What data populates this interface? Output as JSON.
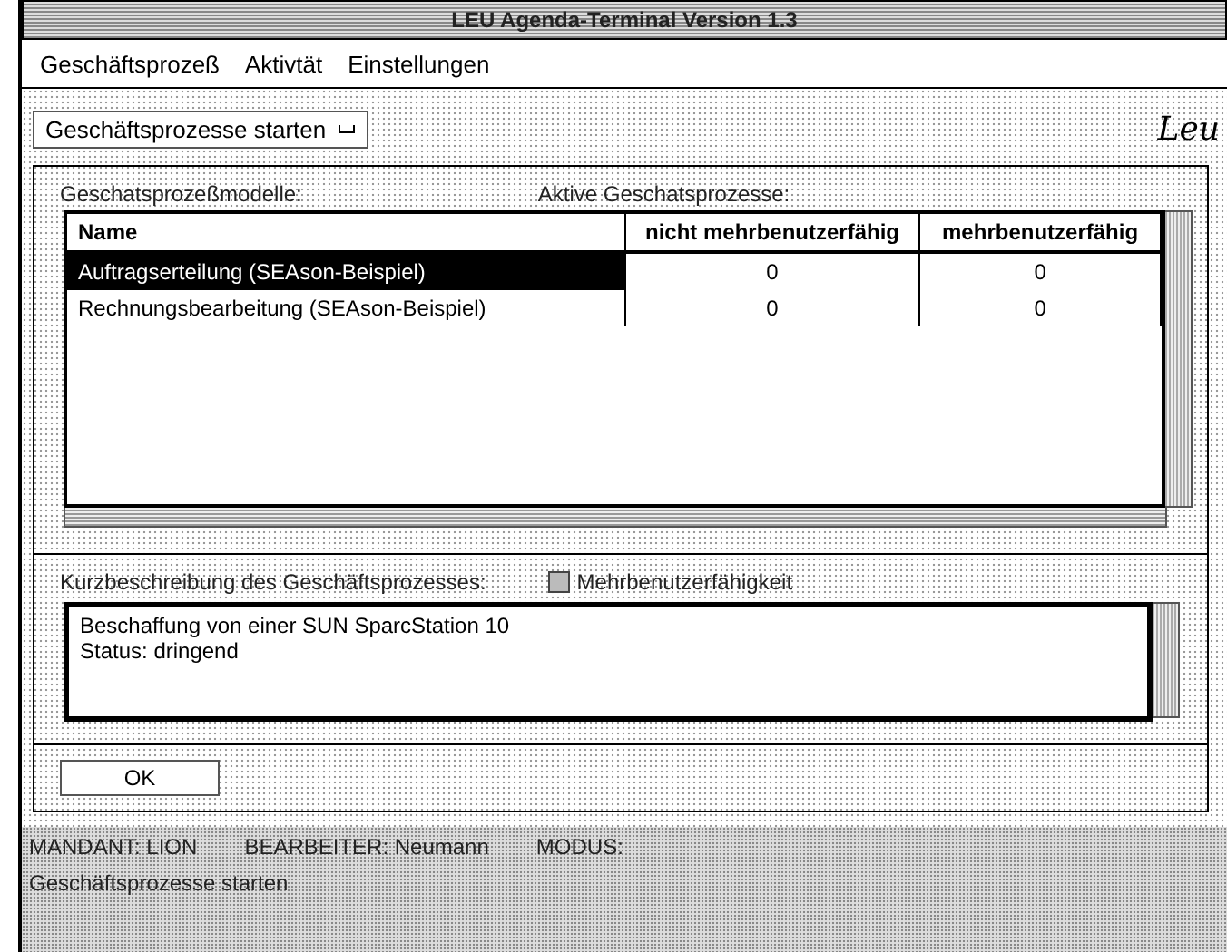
{
  "window": {
    "title": "LEU Agenda-Terminal Version 1.3"
  },
  "menu": [
    {
      "label": "Geschäftsprozeß"
    },
    {
      "label": "Aktivtät"
    },
    {
      "label": "Einstellungen"
    }
  ],
  "toolbar": {
    "dropdown": "Geschäftsprozesse starten",
    "logo": "Leu"
  },
  "models_label": "Geschatsprozeßmodelle:",
  "active_label": "Aktive Geschatsprozesse:",
  "table": {
    "columns": [
      "Name",
      "nicht mehrbenutzerfähig",
      "mehrbenutzerfähig"
    ],
    "rows": [
      {
        "cells": [
          "Auftragserteilung (SEAson-Beispiel)",
          "0",
          "0"
        ],
        "selected": true
      },
      {
        "cells": [
          "Rechnungsbearbeitung (SEAson-Beispiel)",
          "0",
          "0"
        ],
        "selected": false
      }
    ]
  },
  "description": {
    "label": "Kurzbeschreibung des Geschäftsprozesses:",
    "value": "Beschaffung von einer SUN SparcStation 10\nStatus: dringend"
  },
  "multiuser": {
    "label": "Mehrbenutzerfähigkeit",
    "checked": false
  },
  "ok_button": "OK",
  "status_bar": {
    "line1": [
      "MANDANT: LION",
      "BEARBEITER: Neumann",
      "MODUS:"
    ],
    "line2": "Geschäftsprozesse starten"
  }
}
